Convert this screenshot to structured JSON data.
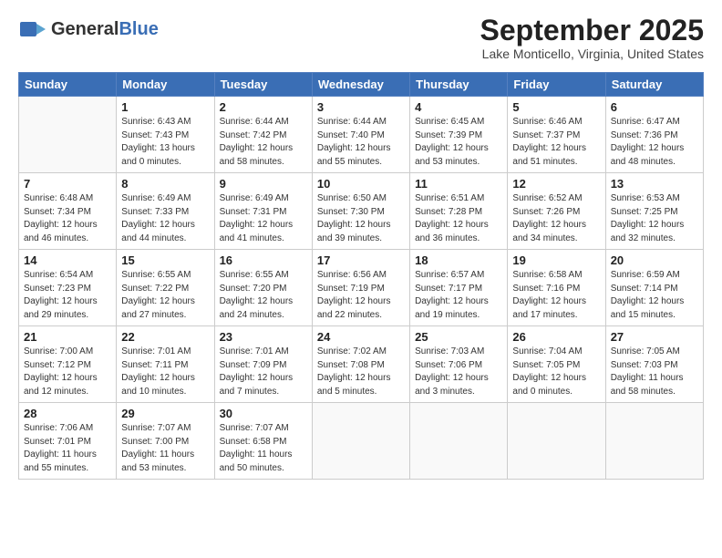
{
  "app": {
    "logo_general": "General",
    "logo_blue": "Blue",
    "month_title": "September 2025",
    "location": "Lake Monticello, Virginia, United States"
  },
  "calendar": {
    "headers": [
      "Sunday",
      "Monday",
      "Tuesday",
      "Wednesday",
      "Thursday",
      "Friday",
      "Saturday"
    ],
    "weeks": [
      [
        {
          "day": "",
          "sunrise": "",
          "sunset": "",
          "daylight": ""
        },
        {
          "day": "1",
          "sunrise": "Sunrise: 6:43 AM",
          "sunset": "Sunset: 7:43 PM",
          "daylight": "Daylight: 13 hours and 0 minutes."
        },
        {
          "day": "2",
          "sunrise": "Sunrise: 6:44 AM",
          "sunset": "Sunset: 7:42 PM",
          "daylight": "Daylight: 12 hours and 58 minutes."
        },
        {
          "day": "3",
          "sunrise": "Sunrise: 6:44 AM",
          "sunset": "Sunset: 7:40 PM",
          "daylight": "Daylight: 12 hours and 55 minutes."
        },
        {
          "day": "4",
          "sunrise": "Sunrise: 6:45 AM",
          "sunset": "Sunset: 7:39 PM",
          "daylight": "Daylight: 12 hours and 53 minutes."
        },
        {
          "day": "5",
          "sunrise": "Sunrise: 6:46 AM",
          "sunset": "Sunset: 7:37 PM",
          "daylight": "Daylight: 12 hours and 51 minutes."
        },
        {
          "day": "6",
          "sunrise": "Sunrise: 6:47 AM",
          "sunset": "Sunset: 7:36 PM",
          "daylight": "Daylight: 12 hours and 48 minutes."
        }
      ],
      [
        {
          "day": "7",
          "sunrise": "Sunrise: 6:48 AM",
          "sunset": "Sunset: 7:34 PM",
          "daylight": "Daylight: 12 hours and 46 minutes."
        },
        {
          "day": "8",
          "sunrise": "Sunrise: 6:49 AM",
          "sunset": "Sunset: 7:33 PM",
          "daylight": "Daylight: 12 hours and 44 minutes."
        },
        {
          "day": "9",
          "sunrise": "Sunrise: 6:49 AM",
          "sunset": "Sunset: 7:31 PM",
          "daylight": "Daylight: 12 hours and 41 minutes."
        },
        {
          "day": "10",
          "sunrise": "Sunrise: 6:50 AM",
          "sunset": "Sunset: 7:30 PM",
          "daylight": "Daylight: 12 hours and 39 minutes."
        },
        {
          "day": "11",
          "sunrise": "Sunrise: 6:51 AM",
          "sunset": "Sunset: 7:28 PM",
          "daylight": "Daylight: 12 hours and 36 minutes."
        },
        {
          "day": "12",
          "sunrise": "Sunrise: 6:52 AM",
          "sunset": "Sunset: 7:26 PM",
          "daylight": "Daylight: 12 hours and 34 minutes."
        },
        {
          "day": "13",
          "sunrise": "Sunrise: 6:53 AM",
          "sunset": "Sunset: 7:25 PM",
          "daylight": "Daylight: 12 hours and 32 minutes."
        }
      ],
      [
        {
          "day": "14",
          "sunrise": "Sunrise: 6:54 AM",
          "sunset": "Sunset: 7:23 PM",
          "daylight": "Daylight: 12 hours and 29 minutes."
        },
        {
          "day": "15",
          "sunrise": "Sunrise: 6:55 AM",
          "sunset": "Sunset: 7:22 PM",
          "daylight": "Daylight: 12 hours and 27 minutes."
        },
        {
          "day": "16",
          "sunrise": "Sunrise: 6:55 AM",
          "sunset": "Sunset: 7:20 PM",
          "daylight": "Daylight: 12 hours and 24 minutes."
        },
        {
          "day": "17",
          "sunrise": "Sunrise: 6:56 AM",
          "sunset": "Sunset: 7:19 PM",
          "daylight": "Daylight: 12 hours and 22 minutes."
        },
        {
          "day": "18",
          "sunrise": "Sunrise: 6:57 AM",
          "sunset": "Sunset: 7:17 PM",
          "daylight": "Daylight: 12 hours and 19 minutes."
        },
        {
          "day": "19",
          "sunrise": "Sunrise: 6:58 AM",
          "sunset": "Sunset: 7:16 PM",
          "daylight": "Daylight: 12 hours and 17 minutes."
        },
        {
          "day": "20",
          "sunrise": "Sunrise: 6:59 AM",
          "sunset": "Sunset: 7:14 PM",
          "daylight": "Daylight: 12 hours and 15 minutes."
        }
      ],
      [
        {
          "day": "21",
          "sunrise": "Sunrise: 7:00 AM",
          "sunset": "Sunset: 7:12 PM",
          "daylight": "Daylight: 12 hours and 12 minutes."
        },
        {
          "day": "22",
          "sunrise": "Sunrise: 7:01 AM",
          "sunset": "Sunset: 7:11 PM",
          "daylight": "Daylight: 12 hours and 10 minutes."
        },
        {
          "day": "23",
          "sunrise": "Sunrise: 7:01 AM",
          "sunset": "Sunset: 7:09 PM",
          "daylight": "Daylight: 12 hours and 7 minutes."
        },
        {
          "day": "24",
          "sunrise": "Sunrise: 7:02 AM",
          "sunset": "Sunset: 7:08 PM",
          "daylight": "Daylight: 12 hours and 5 minutes."
        },
        {
          "day": "25",
          "sunrise": "Sunrise: 7:03 AM",
          "sunset": "Sunset: 7:06 PM",
          "daylight": "Daylight: 12 hours and 3 minutes."
        },
        {
          "day": "26",
          "sunrise": "Sunrise: 7:04 AM",
          "sunset": "Sunset: 7:05 PM",
          "daylight": "Daylight: 12 hours and 0 minutes."
        },
        {
          "day": "27",
          "sunrise": "Sunrise: 7:05 AM",
          "sunset": "Sunset: 7:03 PM",
          "daylight": "Daylight: 11 hours and 58 minutes."
        }
      ],
      [
        {
          "day": "28",
          "sunrise": "Sunrise: 7:06 AM",
          "sunset": "Sunset: 7:01 PM",
          "daylight": "Daylight: 11 hours and 55 minutes."
        },
        {
          "day": "29",
          "sunrise": "Sunrise: 7:07 AM",
          "sunset": "Sunset: 7:00 PM",
          "daylight": "Daylight: 11 hours and 53 minutes."
        },
        {
          "day": "30",
          "sunrise": "Sunrise: 7:07 AM",
          "sunset": "Sunset: 6:58 PM",
          "daylight": "Daylight: 11 hours and 50 minutes."
        },
        {
          "day": "",
          "sunrise": "",
          "sunset": "",
          "daylight": ""
        },
        {
          "day": "",
          "sunrise": "",
          "sunset": "",
          "daylight": ""
        },
        {
          "day": "",
          "sunrise": "",
          "sunset": "",
          "daylight": ""
        },
        {
          "day": "",
          "sunrise": "",
          "sunset": "",
          "daylight": ""
        }
      ]
    ]
  }
}
